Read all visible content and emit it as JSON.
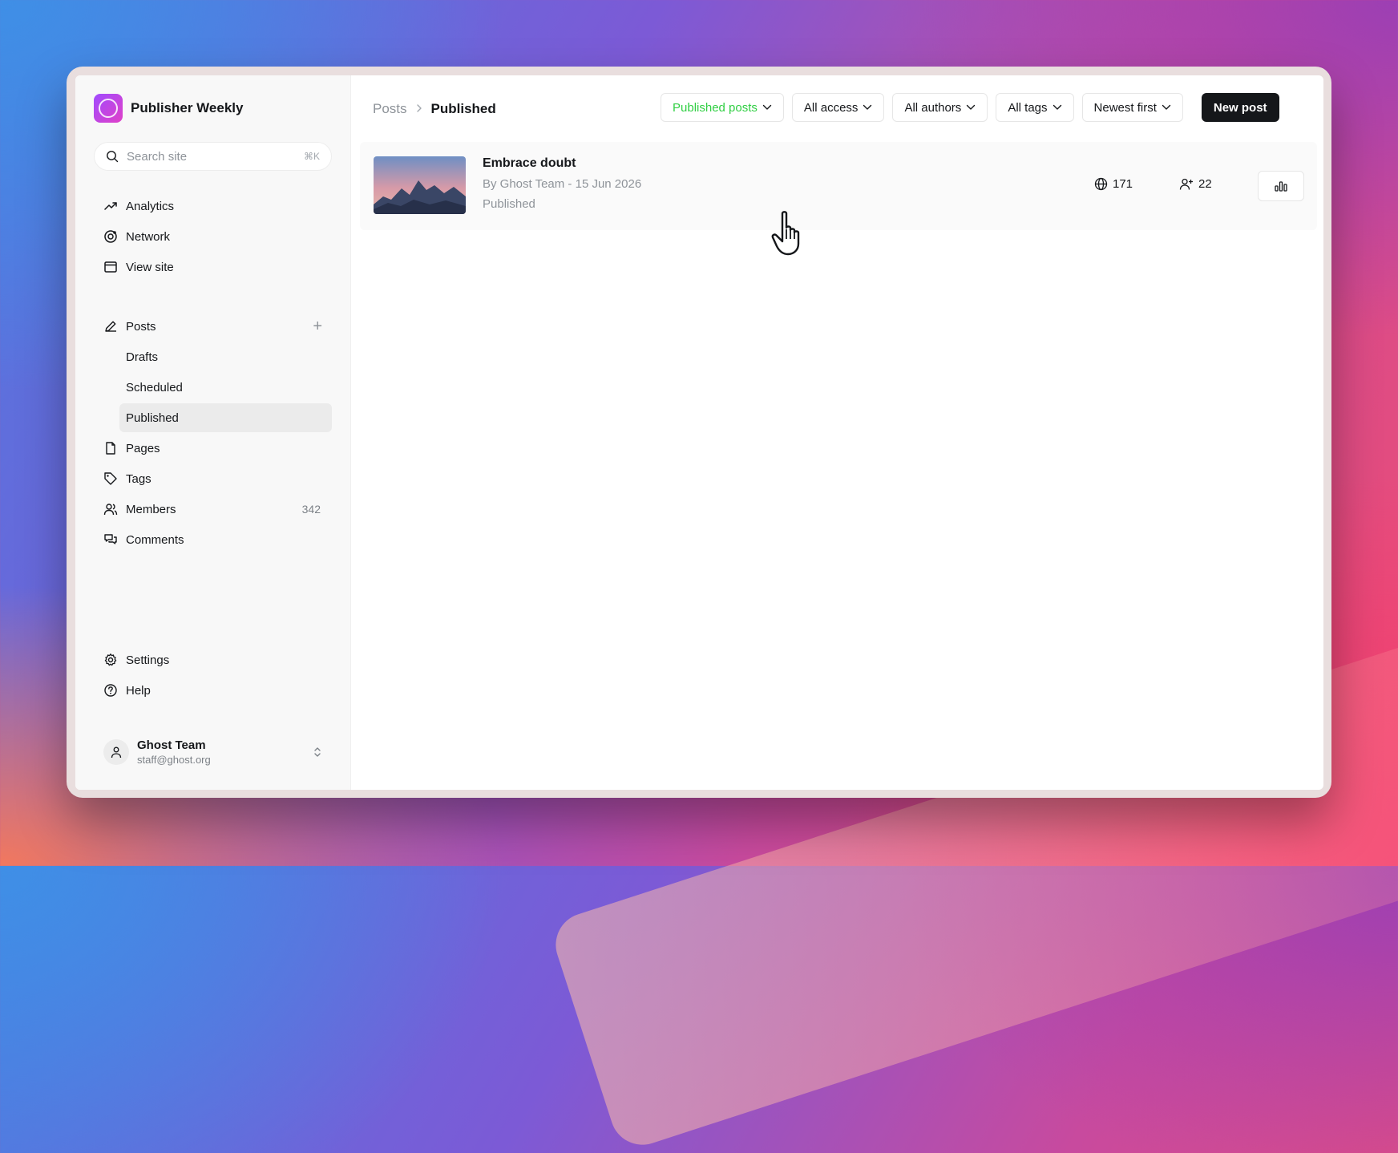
{
  "site": {
    "name": "Publisher Weekly"
  },
  "search": {
    "placeholder": "Search site",
    "shortcut": "⌘K"
  },
  "nav_primary": [
    {
      "label": "Analytics",
      "icon": "trending-up-icon"
    },
    {
      "label": "Network",
      "icon": "network-icon"
    },
    {
      "label": "View site",
      "icon": "browser-icon"
    }
  ],
  "posts_nav": {
    "label": "Posts",
    "subitems": [
      {
        "label": "Drafts"
      },
      {
        "label": "Scheduled"
      },
      {
        "label": "Published",
        "active": true
      }
    ]
  },
  "nav_secondary": [
    {
      "label": "Pages",
      "icon": "page-icon"
    },
    {
      "label": "Tags",
      "icon": "tag-icon"
    },
    {
      "label": "Members",
      "icon": "members-icon",
      "count": "342"
    },
    {
      "label": "Comments",
      "icon": "comments-icon"
    }
  ],
  "nav_bottom": [
    {
      "label": "Settings",
      "icon": "gear-icon"
    },
    {
      "label": "Help",
      "icon": "help-icon"
    }
  ],
  "user": {
    "name": "Ghost Team",
    "email": "staff@ghost.org"
  },
  "breadcrumb": {
    "parent": "Posts",
    "current": "Published"
  },
  "filters": {
    "type": "Published posts",
    "access": "All access",
    "authors": "All authors",
    "tags": "All tags",
    "sort": "Newest first"
  },
  "new_post_label": "New post",
  "posts": [
    {
      "title": "Embrace doubt",
      "meta": "By Ghost Team - 15 Jun 2026",
      "status": "Published",
      "views": "171",
      "members": "22"
    }
  ],
  "colors": {
    "accent_green": "#30cf43",
    "primary_dark": "#15171a"
  }
}
